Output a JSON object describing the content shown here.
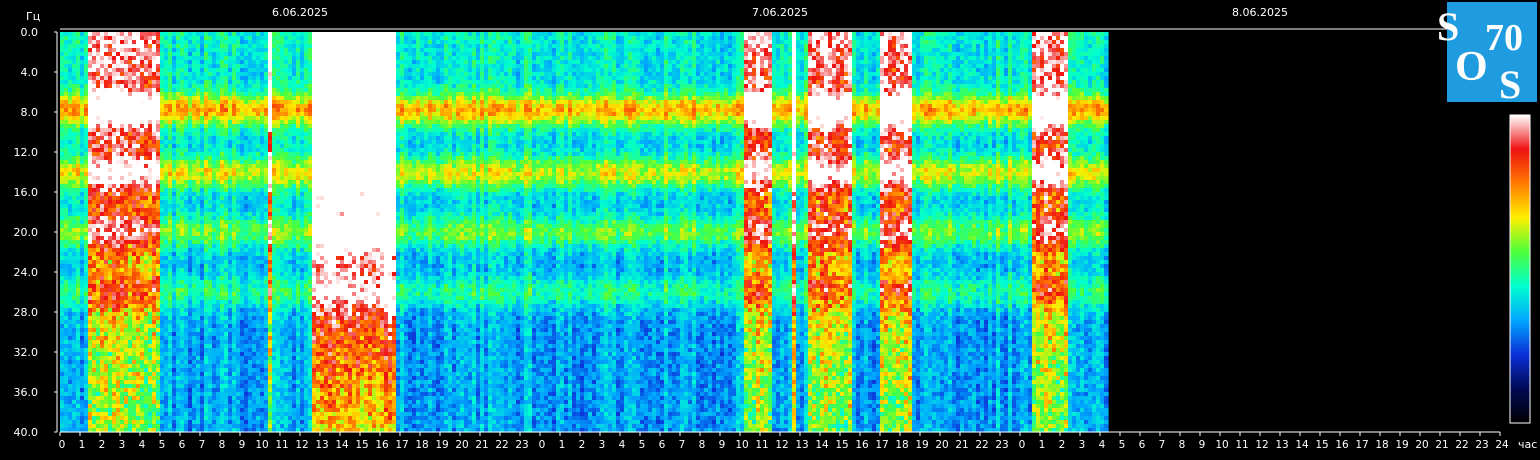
{
  "chart_data": {
    "type": "heatmap",
    "title": "",
    "ylabel": "Гц",
    "xlabel": "час",
    "ylim": [
      0,
      40
    ],
    "y_ticks": [
      "0.0",
      "4.0",
      "8.0",
      "12.0",
      "16.0",
      "20.0",
      "24.0",
      "28.0",
      "32.0",
      "36.0",
      "40.0"
    ],
    "x_ticks": [
      "0",
      "1",
      "2",
      "3",
      "4",
      "5",
      "6",
      "7",
      "8",
      "9",
      "10",
      "11",
      "12",
      "13",
      "14",
      "15",
      "16",
      "17",
      "18",
      "19",
      "20",
      "21",
      "22",
      "23",
      "0",
      "1",
      "2",
      "3",
      "4",
      "5",
      "6",
      "7",
      "8",
      "9",
      "10",
      "11",
      "12",
      "13",
      "14",
      "15",
      "16",
      "17",
      "18",
      "19",
      "20",
      "21",
      "22",
      "23",
      "0",
      "1",
      "2",
      "3",
      "4",
      "5",
      "6",
      "7",
      "8",
      "9",
      "10",
      "11",
      "12",
      "13",
      "14",
      "15",
      "16",
      "17",
      "18",
      "19",
      "20",
      "21",
      "22",
      "23",
      "24"
    ],
    "dates": [
      "6.06.2025",
      "7.06.2025",
      "8.06.2025"
    ],
    "data_end_hour": 52.4,
    "resonance_bands_hz": [
      7.8,
      14.1,
      20.0,
      26.0
    ],
    "intense_intervals": [
      {
        "start_hour": 1.5,
        "end_hour": 5.0,
        "level": "high"
      },
      {
        "start_hour": 10.4,
        "end_hour": 10.6,
        "level": "spike"
      },
      {
        "start_hour": 12.6,
        "end_hour": 16.8,
        "level": "saturated"
      },
      {
        "start_hour": 34.2,
        "end_hour": 35.5,
        "level": "high"
      },
      {
        "start_hour": 36.6,
        "end_hour": 36.8,
        "level": "spike"
      },
      {
        "start_hour": 37.5,
        "end_hour": 39.5,
        "level": "high"
      },
      {
        "start_hour": 41.0,
        "end_hour": 42.5,
        "level": "high"
      },
      {
        "start_hour": 48.6,
        "end_hour": 50.4,
        "level": "high"
      }
    ],
    "colorscale": [
      "#000000",
      "#000a55",
      "#0b2fd8",
      "#00a6ff",
      "#00ffcf",
      "#4cff3a",
      "#ffee00",
      "#ff7a00",
      "#ee1111",
      "#ffffff"
    ],
    "logo_text": [
      "S",
      "70",
      "O",
      "S"
    ]
  }
}
